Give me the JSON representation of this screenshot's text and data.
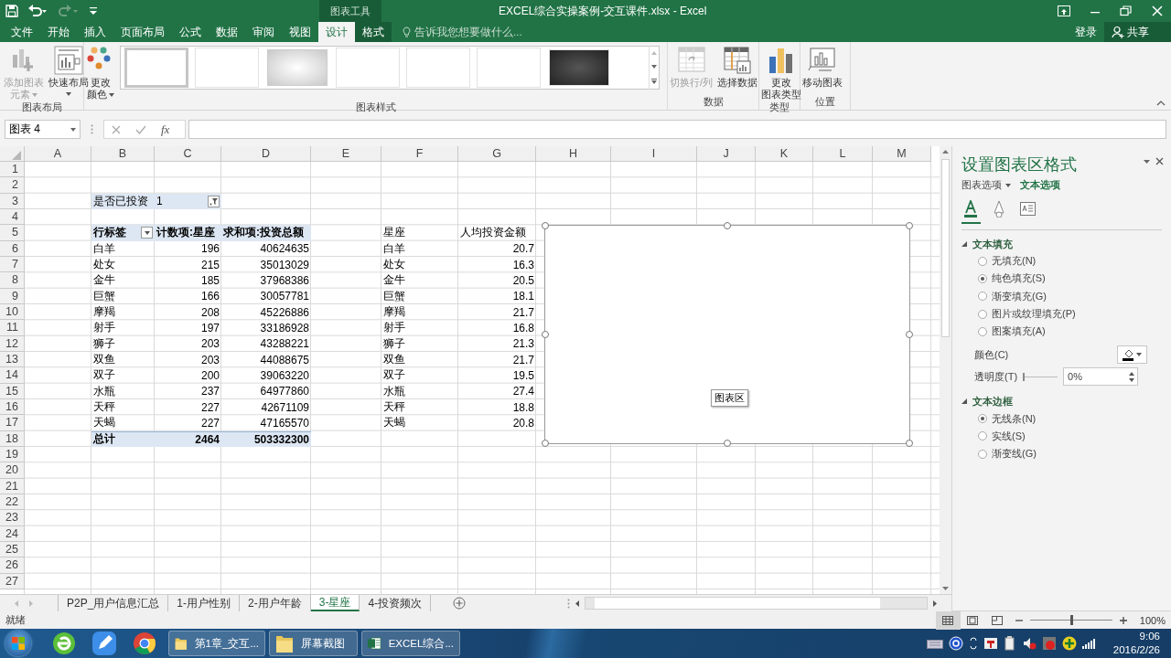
{
  "window": {
    "context_group": "图表工具",
    "title": "EXCEL综合实操案例-交互课件.xlsx - Excel"
  },
  "ribbon_tabs": [
    {
      "label": "文件",
      "selected": false,
      "context": false
    },
    {
      "label": "开始",
      "selected": false,
      "context": false
    },
    {
      "label": "插入",
      "selected": false,
      "context": false
    },
    {
      "label": "页面布局",
      "selected": false,
      "context": false
    },
    {
      "label": "公式",
      "selected": false,
      "context": false
    },
    {
      "label": "数据",
      "selected": false,
      "context": false
    },
    {
      "label": "审阅",
      "selected": false,
      "context": false
    },
    {
      "label": "视图",
      "selected": false,
      "context": false
    },
    {
      "label": "设计",
      "selected": true,
      "context": true
    },
    {
      "label": "格式",
      "selected": false,
      "context": true
    }
  ],
  "tell_me": {
    "placeholder": "告诉我您想要做什么..."
  },
  "account": {
    "sign_in": "登录",
    "share": "共享"
  },
  "ribbon_groups": [
    {
      "label": "图表布局",
      "buttons": [
        {
          "lines": [
            "添加图表",
            "元素"
          ],
          "disabled": true,
          "dropdown": true
        },
        {
          "lines": [
            "快速布局"
          ],
          "disabled": false,
          "dropdown": true
        }
      ]
    },
    {
      "label": "图表样式",
      "buttons": [
        {
          "lines": [
            "更改",
            "颜色"
          ],
          "disabled": false,
          "dropdown": true
        }
      ],
      "gallery": [
        {
          "kind": "plain",
          "selected": true
        },
        {
          "kind": "plain",
          "selected": false
        },
        {
          "kind": "gradient",
          "selected": false
        },
        {
          "kind": "plain",
          "selected": false
        },
        {
          "kind": "plain",
          "selected": false
        },
        {
          "kind": "plain",
          "selected": false
        },
        {
          "kind": "dark",
          "selected": false
        }
      ]
    },
    {
      "label": "数据",
      "buttons": [
        {
          "lines": [
            "切换行/列"
          ],
          "disabled": true,
          "dropdown": false
        },
        {
          "lines": [
            "选择数据"
          ],
          "disabled": false,
          "dropdown": false
        }
      ]
    },
    {
      "label": "类型",
      "buttons": [
        {
          "lines": [
            "更改",
            "图表类型"
          ],
          "disabled": false,
          "dropdown": false
        }
      ]
    },
    {
      "label": "位置",
      "buttons": [
        {
          "lines": [
            "移动图表"
          ],
          "disabled": false,
          "dropdown": false
        }
      ]
    }
  ],
  "formula_bar": {
    "name_box": "图表 4",
    "function_label": "fx"
  },
  "sheet": {
    "columns": [
      "A",
      "B",
      "C",
      "D",
      "E",
      "F",
      "G",
      "H",
      "I",
      "J",
      "K",
      "L",
      "M"
    ],
    "row_numbers": [
      "1",
      "2",
      "3",
      "4",
      "5",
      "6",
      "7",
      "8",
      "9",
      "10",
      "11",
      "12",
      "13",
      "14",
      "15",
      "16",
      "17",
      "18",
      "19",
      "20",
      "21",
      "22",
      "23",
      "24",
      "25",
      "26",
      "27"
    ]
  },
  "pivot_table": {
    "filter": {
      "label": "是否已投资",
      "value": "1"
    },
    "headers": [
      "行标签",
      "计数项:星座",
      "求和项:投资总额"
    ],
    "rows": [
      {
        "label": "白羊",
        "count": "196",
        "sum": "40624635"
      },
      {
        "label": "处女",
        "count": "215",
        "sum": "35013029"
      },
      {
        "label": "金牛",
        "count": "185",
        "sum": "37968386"
      },
      {
        "label": "巨蟹",
        "count": "166",
        "sum": "30057781"
      },
      {
        "label": "摩羯",
        "count": "208",
        "sum": "45226886"
      },
      {
        "label": "射手",
        "count": "197",
        "sum": "33186928"
      },
      {
        "label": "狮子",
        "count": "203",
        "sum": "43288221"
      },
      {
        "label": "双鱼",
        "count": "203",
        "sum": "44088675"
      },
      {
        "label": "双子",
        "count": "200",
        "sum": "39063220"
      },
      {
        "label": "水瓶",
        "count": "237",
        "sum": "64977860"
      },
      {
        "label": "天秤",
        "count": "227",
        "sum": "42671109"
      },
      {
        "label": "天蝎",
        "count": "227",
        "sum": "47165570"
      }
    ],
    "total": {
      "label": "总计",
      "count": "2464",
      "sum": "503332300"
    }
  },
  "average_table": {
    "headers": [
      "星座",
      "人均投资金额"
    ],
    "rows": [
      {
        "name": "白羊",
        "value": "20.7"
      },
      {
        "name": "处女",
        "value": "16.3"
      },
      {
        "name": "金牛",
        "value": "20.5"
      },
      {
        "name": "巨蟹",
        "value": "18.1"
      },
      {
        "name": "摩羯",
        "value": "21.7"
      },
      {
        "name": "射手",
        "value": "16.8"
      },
      {
        "name": "狮子",
        "value": "21.3"
      },
      {
        "name": "双鱼",
        "value": "21.7"
      },
      {
        "name": "双子",
        "value": "19.5"
      },
      {
        "name": "水瓶",
        "value": "27.4"
      },
      {
        "name": "天秤",
        "value": "18.8"
      },
      {
        "name": "天蝎",
        "value": "20.8"
      }
    ]
  },
  "chart_object": {
    "selected": true,
    "tooltip": "图表区"
  },
  "format_pane": {
    "title": "设置图表区格式",
    "tabs": [
      {
        "label": "图表选项",
        "selected": false
      },
      {
        "label": "文本选项",
        "selected": true
      }
    ],
    "icon_tabs": [
      {
        "selected": true
      },
      {
        "selected": false
      },
      {
        "selected": false
      }
    ],
    "sections": [
      {
        "title": "文本填充",
        "expanded": true,
        "items": [
          {
            "kind": "radio",
            "label": "无填充(N)",
            "selected": false
          },
          {
            "kind": "radio",
            "label": "纯色填充(S)",
            "selected": true
          },
          {
            "kind": "radio",
            "label": "渐变填充(G)",
            "selected": false
          },
          {
            "kind": "radio",
            "label": "图片或纹理填充(P)",
            "selected": false
          },
          {
            "kind": "radio",
            "label": "图案填充(A)",
            "selected": false
          },
          {
            "kind": "color",
            "label": "颜色(C)"
          },
          {
            "kind": "slider",
            "label": "透明度(T)",
            "level": 0,
            "value": "0%"
          }
        ]
      },
      {
        "title": "文本边框",
        "expanded": true,
        "items": [
          {
            "kind": "radio",
            "label": "无线条(N)",
            "selected": true
          },
          {
            "kind": "radio",
            "label": "实线(S)",
            "selected": false
          },
          {
            "kind": "radio",
            "label": "渐变线(G)",
            "selected": false
          }
        ]
      }
    ]
  },
  "sheet_tabs": [
    {
      "label": "P2P_用户信息汇总",
      "selected": false
    },
    {
      "label": "1-用户性别",
      "selected": false
    },
    {
      "label": "2-用户年龄",
      "selected": false
    },
    {
      "label": "3-星座",
      "selected": true
    },
    {
      "label": "4-投资频次",
      "selected": false
    }
  ],
  "status_bar": {
    "text": "就绪",
    "views": [
      {
        "selected": true
      },
      {
        "selected": false
      },
      {
        "selected": false
      }
    ],
    "zoom": {
      "level": 0.5,
      "value": "100%"
    }
  },
  "taskbar": {
    "tasks": [
      {
        "label": "第1章_交互..."
      },
      {
        "label": "屏幕截图"
      },
      {
        "label": "EXCEL综合..."
      }
    ],
    "time": "9:06",
    "date": "2016/2/26"
  }
}
